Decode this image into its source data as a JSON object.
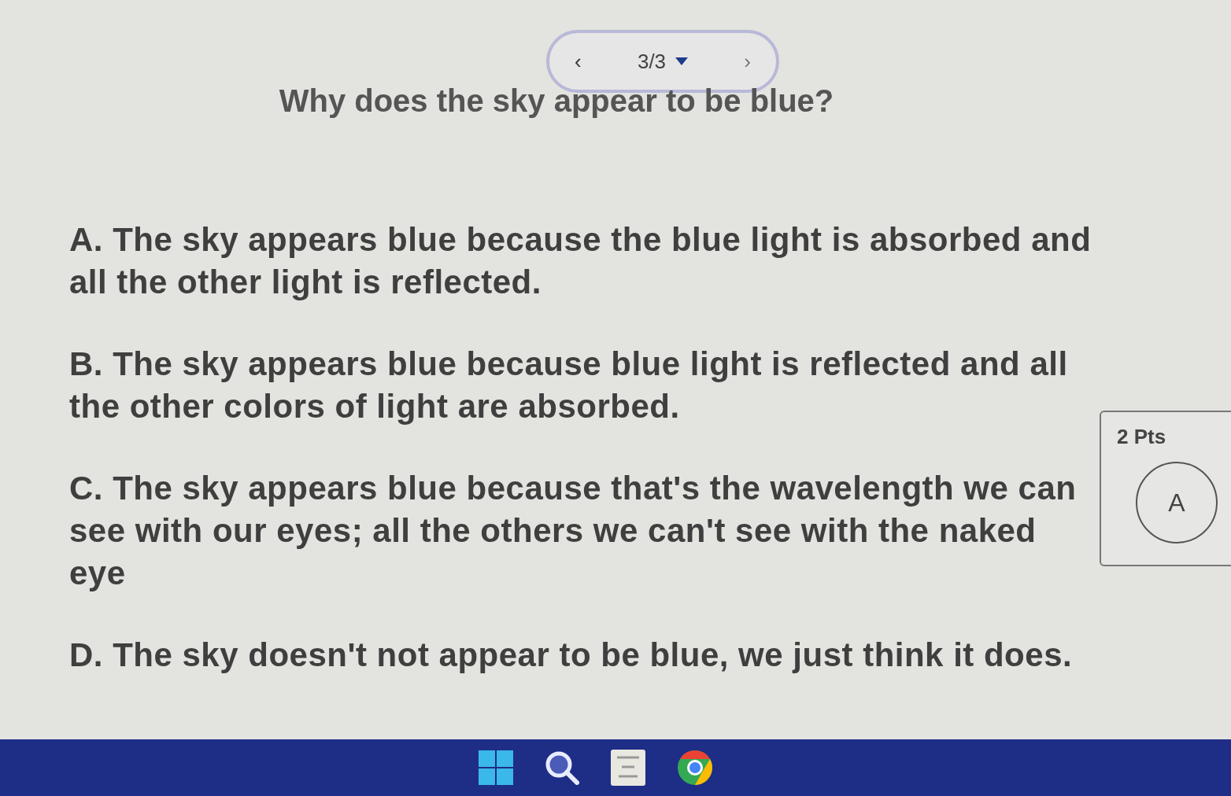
{
  "pager": {
    "previous": "‹",
    "position": "3/3",
    "next": "›"
  },
  "question": "Why does the sky appear to be blue?",
  "options": [
    {
      "text": "A. The sky appears blue because the blue light is absorbed and all the other light is reflected."
    },
    {
      "text": "B. The sky appears blue because blue light is reflected and all the other colors of light are absorbed."
    },
    {
      "text": "C. The sky appears blue because that's the wavelength we can see with our eyes; all the others we can't see with the naked eye"
    },
    {
      "text": "D. The sky doesn't not appear to be blue, we just think it does."
    }
  ],
  "answer_panel": {
    "points": "2 Pts",
    "bubbles": [
      {
        "label": "A",
        "selected": false
      }
    ]
  },
  "taskbar": {
    "icons": [
      {
        "kind": "start"
      },
      {
        "kind": "search"
      },
      {
        "kind": "app"
      },
      {
        "kind": "browser"
      }
    ]
  }
}
